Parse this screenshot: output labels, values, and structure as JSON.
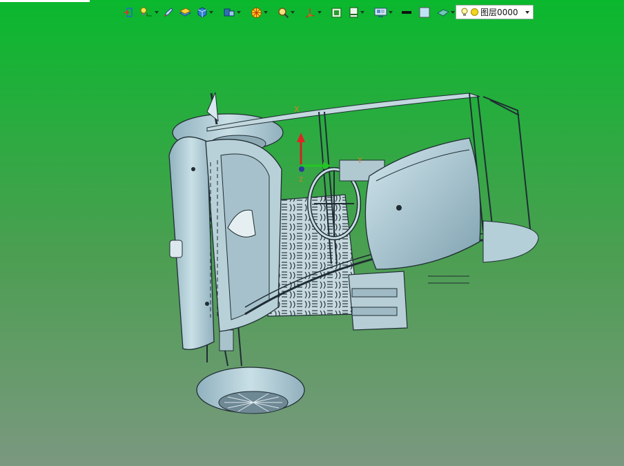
{
  "toolbar": {
    "icons": [
      "import-icon",
      "lightbulb-icon",
      "pen-icon",
      "layer-icon",
      "cube-icon",
      "view-cube-icon",
      "color-wheel-icon",
      "zoom-icon",
      "axes-icon",
      "fit-view-icon",
      "section-icon",
      "display-mode-icon",
      "line-color-icon",
      "fill-color-icon",
      "plane-icon"
    ],
    "colors": {
      "line_color": "#111111",
      "fill_color": "#bfe3f5"
    }
  },
  "layer_selector": {
    "value": "图层0000"
  },
  "viewport": {
    "background_top": "#0ab82e",
    "background_bottom": "#7b9880",
    "model_color": "#b5cfd8"
  },
  "triad": {
    "x_label": "X",
    "y_label": "Y",
    "z_label": "Z"
  }
}
